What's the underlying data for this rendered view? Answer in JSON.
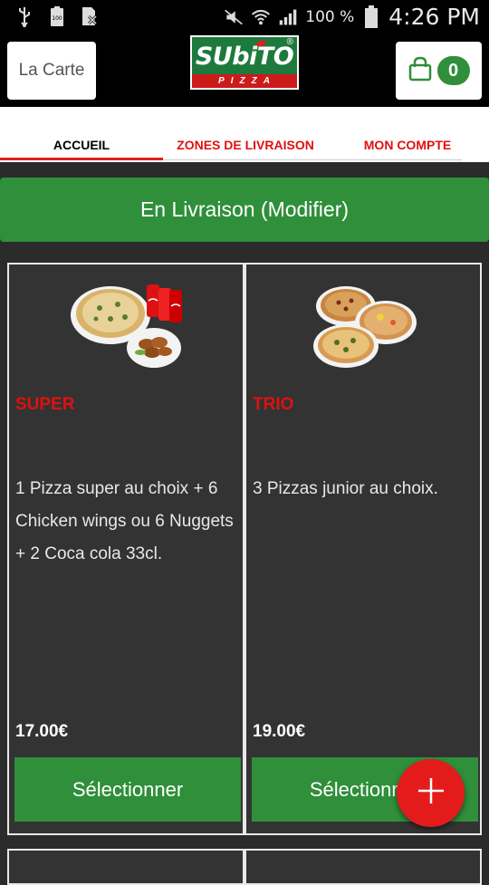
{
  "status_bar": {
    "battery_percent": "100 %",
    "time": "4:26 PM",
    "icons": [
      "usb-icon",
      "battery-full-icon",
      "sim-blocked-icon",
      "mute-icon",
      "wifi-icon",
      "signal-icon",
      "battery-icon"
    ]
  },
  "app_bar": {
    "menu_label": "La Carte",
    "logo_text": "SUbiTO",
    "logo_subtext": "PIZZA",
    "logo_reg": "®",
    "cart_count": "0"
  },
  "tabs": [
    {
      "label": "ACCUEIL",
      "active": true
    },
    {
      "label": "ZONES DE LIVRAISON",
      "active": false
    },
    {
      "label": "MON COMPTE",
      "active": false
    }
  ],
  "delivery_button": "En Livraison (Modifier)",
  "products": [
    {
      "title": "SUPER",
      "description": "1 Pizza super au choix  + 6 Chicken wings ou 6 Nuggets  + 2 Coca cola 33cl.",
      "price": "17.00€",
      "button": "Sélectionner"
    },
    {
      "title": "TRIO",
      "description": "3 Pizzas junior au choix.",
      "price": "19.00€",
      "button": "Sélectionner"
    }
  ],
  "colors": {
    "accent_green": "#2f8f3a",
    "accent_red": "#e41b1b",
    "card_bg": "#333333",
    "page_bg": "#2b2b2b"
  }
}
